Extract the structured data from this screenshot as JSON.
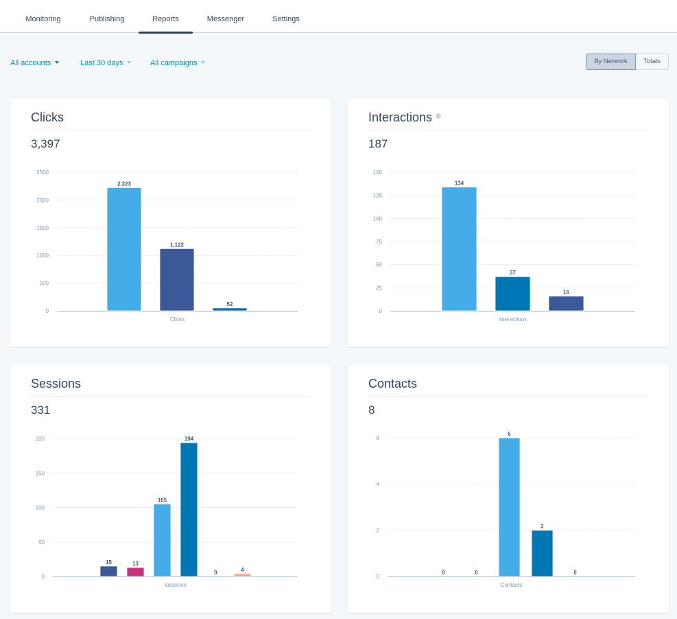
{
  "nav": {
    "tabs": [
      {
        "label": "Monitoring",
        "active": false
      },
      {
        "label": "Publishing",
        "active": false
      },
      {
        "label": "Reports",
        "active": true
      },
      {
        "label": "Messenger",
        "active": false
      },
      {
        "label": "Settings",
        "active": false
      }
    ]
  },
  "filters": {
    "accounts": "All accounts",
    "date_range": "Last 30 days",
    "campaigns": "All campaigns"
  },
  "view_toggle": {
    "by_network": "By Network",
    "totals": "Totals",
    "selected": "By Network"
  },
  "colors": {
    "light_blue": "#45acea",
    "navy": "#3b5998",
    "teal_blue": "#0077b5",
    "magenta": "#c9317c",
    "salmon": "#f8a18b",
    "axis_text": "#7c98b6",
    "label_text": "#425b76"
  },
  "cards": {
    "clicks": {
      "title": "Clicks",
      "total": "3,397"
    },
    "interactions": {
      "title": "Interactions",
      "total": "187",
      "has_info_icon": true
    },
    "sessions": {
      "title": "Sessions",
      "total": "331"
    },
    "contacts": {
      "title": "Contacts",
      "total": "8"
    }
  },
  "chart_data": [
    {
      "id": "clicks",
      "type": "bar",
      "title": "Clicks",
      "xlabel": "Clicks",
      "ylabel": "",
      "ylim": [
        0,
        2500
      ],
      "yticks": [
        0,
        500,
        1000,
        1500,
        2000,
        2500
      ],
      "grid": true,
      "values": [
        2223,
        1122,
        52
      ],
      "value_labels": [
        "2,223",
        "1,122",
        "52"
      ],
      "bar_colors": [
        "#45acea",
        "#3b5998",
        "#0077b5"
      ]
    },
    {
      "id": "interactions",
      "type": "bar",
      "title": "Interactions",
      "xlabel": "Interactions",
      "ylabel": "",
      "ylim": [
        0,
        150
      ],
      "yticks": [
        0,
        25,
        50,
        75,
        100,
        125,
        150
      ],
      "grid": true,
      "values": [
        134,
        37,
        16
      ],
      "value_labels": [
        "134",
        "37",
        "16"
      ],
      "bar_colors": [
        "#45acea",
        "#0077b5",
        "#3b5998"
      ]
    },
    {
      "id": "sessions",
      "type": "bar",
      "title": "Sessions",
      "xlabel": "Sessions",
      "ylabel": "",
      "ylim": [
        0,
        200
      ],
      "yticks": [
        0,
        50,
        100,
        150,
        200
      ],
      "grid": true,
      "values": [
        15,
        13,
        105,
        194,
        0,
        4
      ],
      "value_labels": [
        "15",
        "13",
        "105",
        "194",
        "0",
        "4"
      ],
      "bar_colors": [
        "#3b5998",
        "#c9317c",
        "#45acea",
        "#0077b5",
        "#0077b5",
        "#f8a18b"
      ]
    },
    {
      "id": "contacts",
      "type": "bar",
      "title": "Contacts",
      "xlabel": "Contacts",
      "ylabel": "",
      "ylim": [
        0,
        6
      ],
      "yticks": [
        0,
        2,
        4,
        6
      ],
      "grid": true,
      "values": [
        0,
        0,
        6,
        2,
        0
      ],
      "value_labels": [
        "0",
        "0",
        "6",
        "2",
        "0"
      ],
      "bar_colors": [
        "#3b5998",
        "#c9317c",
        "#45acea",
        "#0077b5",
        "#f8a18b"
      ]
    }
  ]
}
